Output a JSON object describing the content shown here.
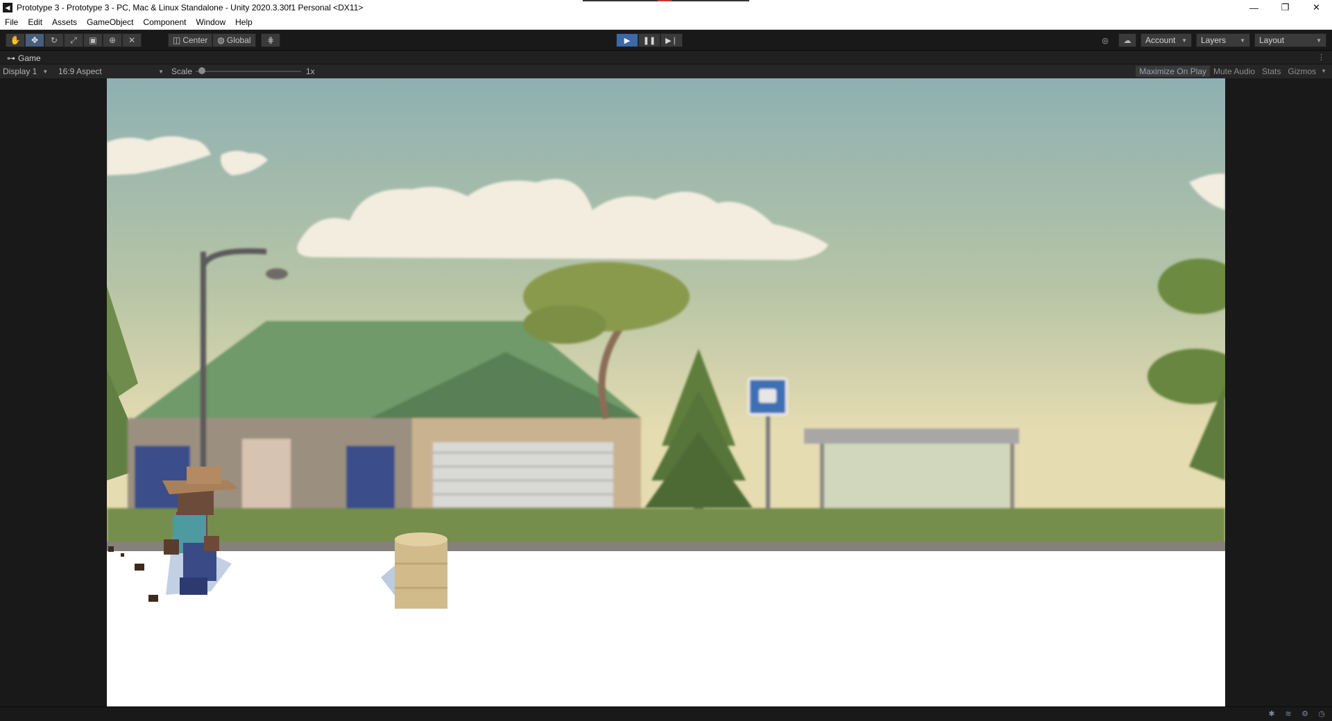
{
  "window": {
    "title": "Prototype 3 - Prototype 3 - PC, Mac & Linux Standalone - Unity 2020.3.30f1 Personal <DX11>",
    "app_icon": "unity-icon",
    "controls": [
      "minimize-icon",
      "restore-icon",
      "close-icon"
    ]
  },
  "menu": {
    "items": [
      "File",
      "Edit",
      "Assets",
      "GameObject",
      "Component",
      "Window",
      "Help"
    ]
  },
  "toolbar": {
    "tools": [
      "hand-tool-icon",
      "move-tool-icon",
      "rotate-tool-icon",
      "scale-tool-icon",
      "rect-tool-icon",
      "transform-tool-icon",
      "custom-tool-icon"
    ],
    "active_tool": "move-tool-icon",
    "pivot_mode": "Center",
    "pivot_rotation": "Global",
    "grid_snapping_icon": "grid-snap-icon",
    "play_controls": [
      "play-icon",
      "pause-icon",
      "step-icon"
    ],
    "play_active": true,
    "collab_icon": "collab-icon",
    "cloud_icon": "cloud-icon",
    "account_label": "Account",
    "layers_label": "Layers",
    "layout_label": "Layout"
  },
  "game_panel": {
    "tab_label": "Game",
    "display": "Display 1",
    "aspect": "16:9 Aspect",
    "scale_label": "Scale",
    "scale_value": "1x",
    "maximize_on_play": "Maximize On Play",
    "mute_audio": "Mute Audio",
    "stats": "Stats",
    "gizmos": "Gizmos"
  },
  "colors": {
    "editor_bg": "#191919",
    "play_active": "#3c6aa8",
    "sky_top": "#8fb1b2",
    "sky_bottom": "#e8dcb0",
    "ground": "#ffffff",
    "roof": "#6f9a6a"
  },
  "status_bar": {
    "icons": [
      "auto-generate-lighting-icon",
      "cache-server-icon",
      "debug-icon",
      "collab-status-icon"
    ]
  }
}
